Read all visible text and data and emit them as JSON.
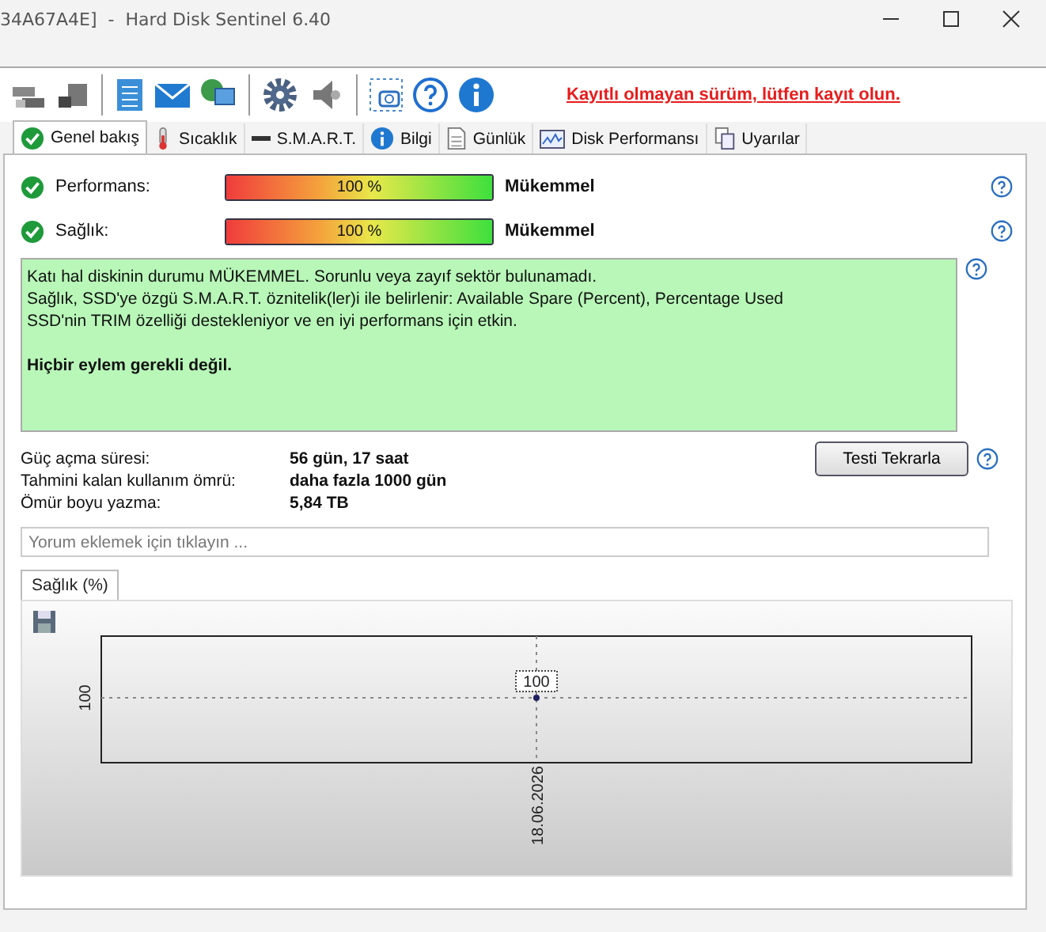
{
  "window": {
    "title": "34A67A4E]  -  Hard Disk Sentinel 6.40"
  },
  "toolbar": {
    "notice": "Kayıtlı olmayan sürüm, lütfen kayıt olun."
  },
  "tabs": [
    {
      "label": "Genel bakış",
      "selected": true
    },
    {
      "label": "Sıcaklık",
      "selected": false
    },
    {
      "label": "S.M.A.R.T.",
      "selected": false
    },
    {
      "label": "Bilgi",
      "selected": false
    },
    {
      "label": "Günlük",
      "selected": false
    },
    {
      "label": "Disk Performansı",
      "selected": false
    },
    {
      "label": "Uyarılar",
      "selected": false
    }
  ],
  "gauges": [
    {
      "label": "Performans:",
      "level": 1,
      "reading": "100 %",
      "status": "Mükemmel"
    },
    {
      "label": "Sağlık:",
      "level": 1,
      "reading": "100 %",
      "status": "Mükemmel"
    }
  ],
  "status_box": {
    "lines": [
      "Katı hal diskinin durumu MÜKEMMEL. Sorunlu veya zayıf sektör bulunamadı.",
      "Sağlık, SSD'ye özgü S.M.A.R.T. öznitelik(ler)i ile belirlenir:  Available Spare (Percent), Percentage Used",
      "SSD'nin TRIM özelliği destekleniyor ve en iyi performans için etkin."
    ],
    "action": "Hiçbir eylem gerekli değil."
  },
  "info": [
    {
      "label": "Güç açma süresi:",
      "value": "56 gün, 17 saat"
    },
    {
      "label": "Tahmini kalan kullanım ömrü:",
      "value": "daha fazla 1000 gün"
    },
    {
      "label": "Ömür boyu yazma:",
      "value": "5,84 TB"
    }
  ],
  "retest_button": "Testi Tekrarla",
  "comment": {
    "placeholder": "Yorum eklemek için tıklayın ..."
  },
  "chart_tab": {
    "label": "Sağlık (%)",
    "selected": true
  },
  "chart": {
    "y_tick": "100",
    "x_label": "18.06.2026",
    "point_label": "100"
  }
}
